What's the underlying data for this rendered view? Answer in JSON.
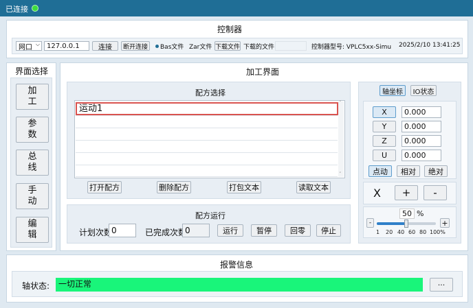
{
  "titlebar": {
    "status": "已连接"
  },
  "controller": {
    "title": "控制器",
    "mode_value": "网口",
    "ip_value": "127.0.0.1",
    "connect_label": "连接",
    "disconnect_label": "断开连接",
    "bas_label": "Bas文件",
    "zar_label": "Zar文件",
    "download_label": "下载文件",
    "downloaded_label": "下载的文件:",
    "model_label": "控制器型号: VPLC5xx-Simu",
    "datetime": "2025/2/10 13:41:25"
  },
  "nav": {
    "title": "界面选择",
    "items": [
      {
        "label": "加工"
      },
      {
        "label": "参数"
      },
      {
        "label": "总线"
      },
      {
        "label": "手动"
      },
      {
        "label": "编辑"
      }
    ]
  },
  "main": {
    "title": "加工界面"
  },
  "recipe_select": {
    "title": "配方选择",
    "rows": [
      "运动1",
      "",
      "",
      "",
      "",
      ""
    ],
    "open_label": "打开配方",
    "delete_label": "删除配方",
    "pack_label": "打包文本",
    "read_label": "读取文本"
  },
  "recipe_run": {
    "title": "配方运行",
    "planned_label": "计划次数",
    "planned_value": "0",
    "done_label": "已完成次数",
    "done_value": "0",
    "run_label": "运行",
    "pause_label": "暂停",
    "home_label": "回零",
    "stop_label": "停止"
  },
  "axis": {
    "tab_coords": "轴坐标",
    "tab_io": "IO状态",
    "axes": [
      {
        "name": "X",
        "value": "0.000"
      },
      {
        "name": "Y",
        "value": "0.000"
      },
      {
        "name": "Z",
        "value": "0.000"
      },
      {
        "name": "U",
        "value": "0.000"
      }
    ],
    "mode_jog": "点动",
    "mode_rel": "相对",
    "mode_abs": "绝对",
    "selected_axis": "X",
    "plus_label": "+",
    "minus_label": "-",
    "speed_value": "50",
    "speed_unit": "%",
    "speed_fraction": 0.5,
    "slider_minus": "-",
    "slider_plus": "+",
    "ticks": [
      "1",
      "20",
      "40",
      "60",
      "80",
      "100%"
    ]
  },
  "alarm": {
    "title": "报警信息",
    "axis_state_label": "轴状态:",
    "axis_state_value": "一切正常",
    "more_label": "···"
  },
  "colors": {
    "accent": "#1f6e96",
    "connected": "#3ddc3d",
    "status_ok": "#19f57a",
    "selected_row_border": "#d9534f"
  }
}
